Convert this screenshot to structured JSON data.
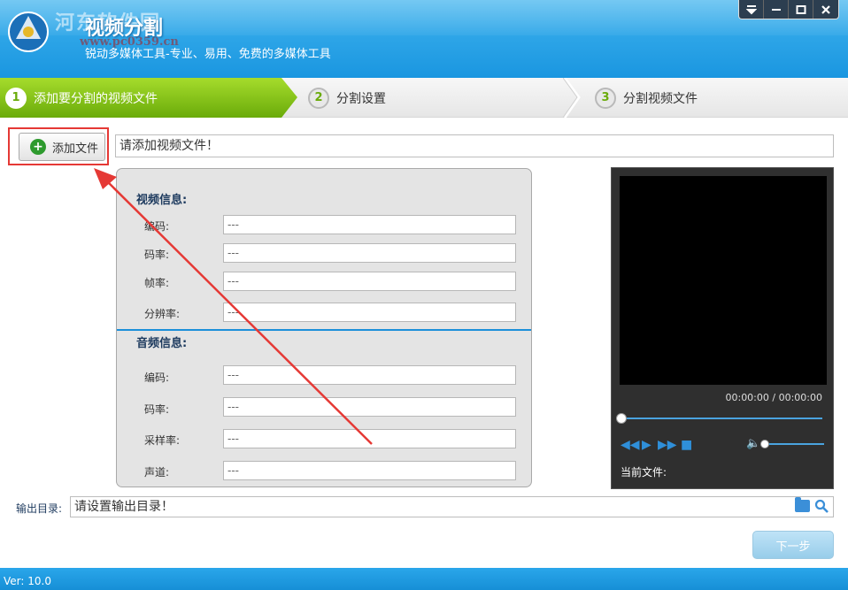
{
  "header": {
    "watermark": "河东软件园",
    "watermark_url": "www.pc0359.cn",
    "title": "视频分割",
    "subtitle": "锐动多媒体工具-专业、易用、免费的多媒体工具",
    "controls": [
      "menu-icon",
      "minimize-icon",
      "maximize-icon",
      "close-icon"
    ]
  },
  "steps": [
    {
      "num": "1",
      "label": "添加要分割的视频文件"
    },
    {
      "num": "2",
      "label": "分割设置"
    },
    {
      "num": "3",
      "label": "分割视频文件"
    }
  ],
  "add_file": {
    "button_label": "添加文件",
    "path_value": "请添加视频文件！"
  },
  "video_info": {
    "title": "视频信息:",
    "fields": [
      {
        "label": "编码:",
        "value": "---"
      },
      {
        "label": "码率:",
        "value": "---"
      },
      {
        "label": "帧率:",
        "value": "---"
      },
      {
        "label": "分辨率:",
        "value": "---"
      }
    ]
  },
  "audio_info": {
    "title": "音频信息:",
    "fields": [
      {
        "label": "编码:",
        "value": "---"
      },
      {
        "label": "码率:",
        "value": "---"
      },
      {
        "label": "采样率:",
        "value": "---"
      },
      {
        "label": "声道:",
        "value": "---"
      }
    ]
  },
  "preview": {
    "time": "00:00:00 / 00:00:00",
    "current_file_label": "当前文件:",
    "progress": 0
  },
  "output": {
    "label": "输出目录:",
    "value": "请设置输出目录！"
  },
  "next_button": "下一步",
  "footer": {
    "version": "Ver: 10.0"
  },
  "colors": {
    "accent_blue": "#1a96e0",
    "step_green": "#6aab0a",
    "annotation_red": "#e53935"
  }
}
